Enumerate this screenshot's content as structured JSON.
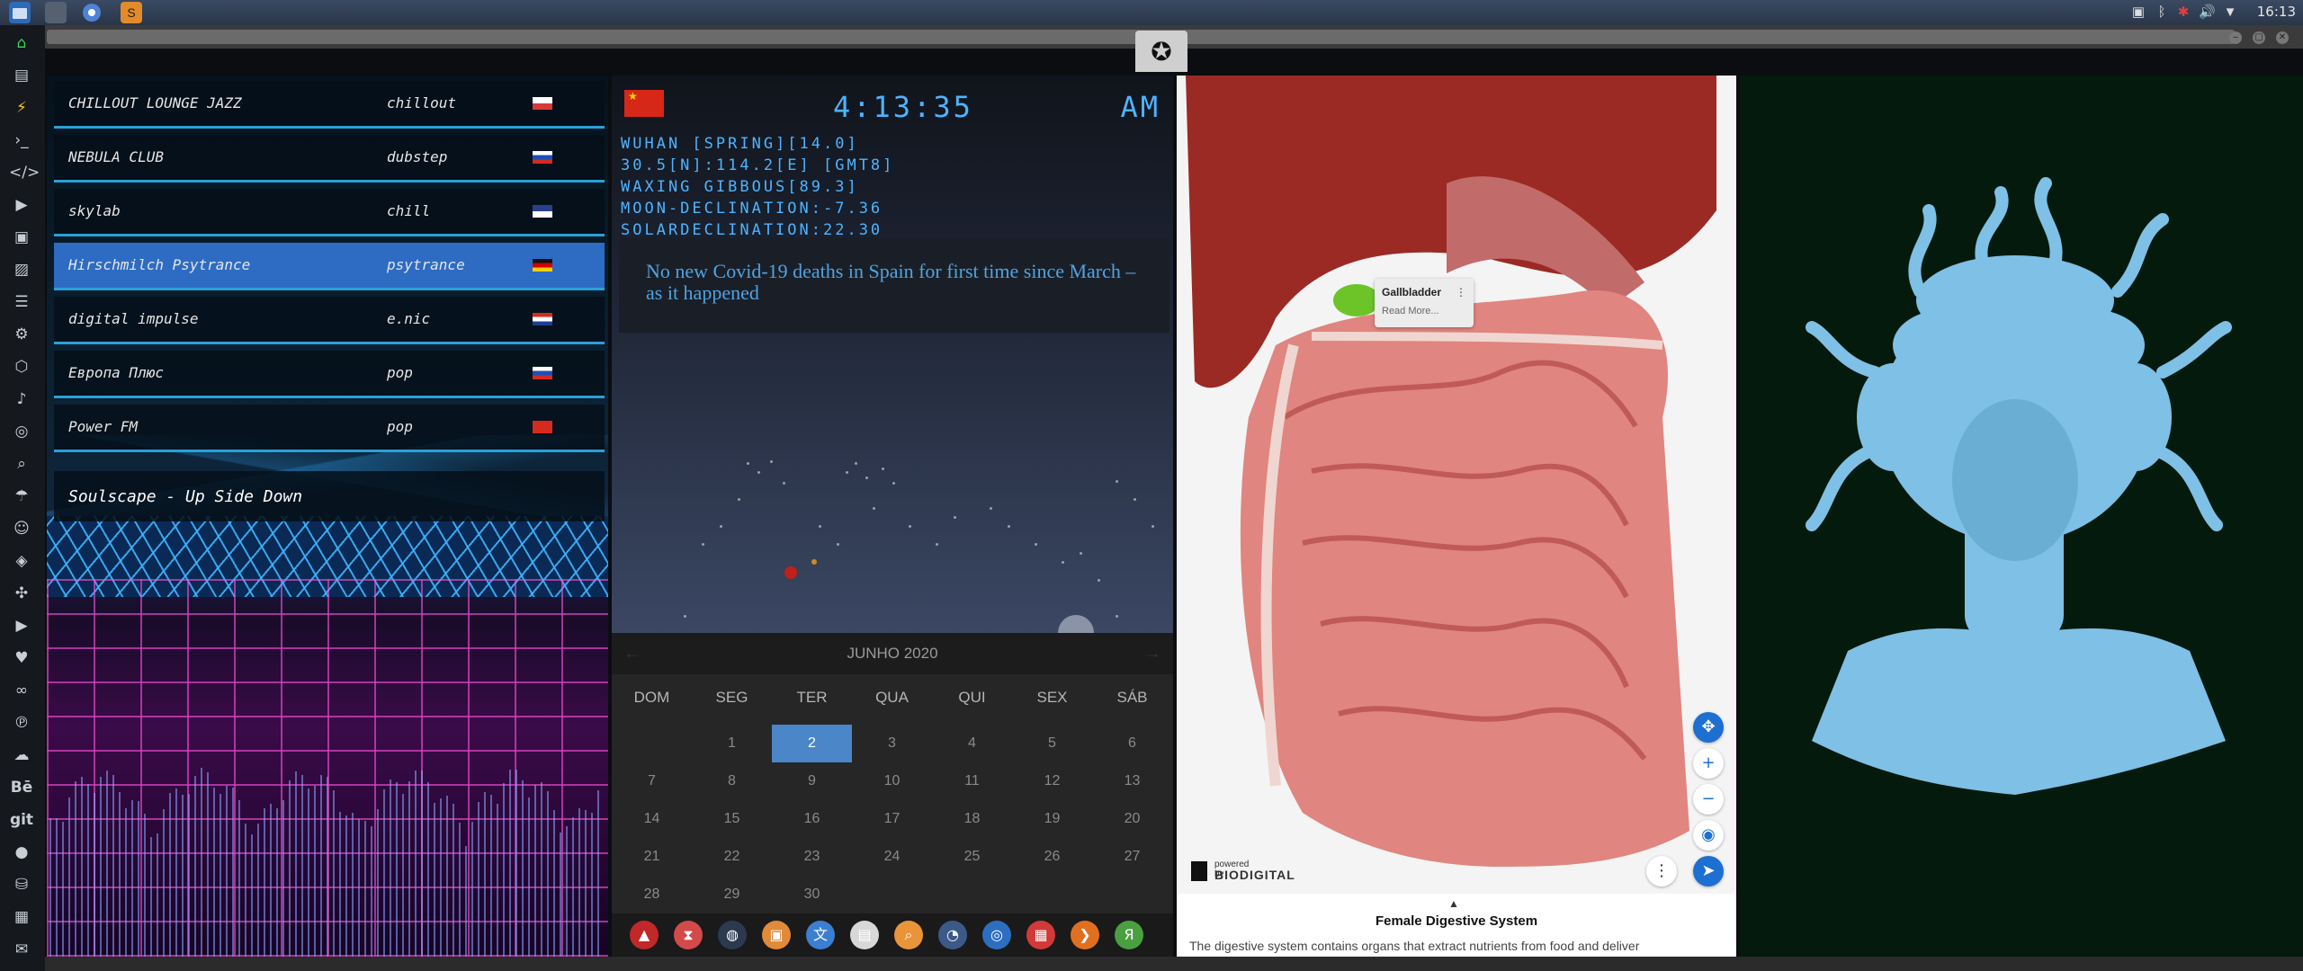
{
  "topbar": {
    "clock": "16:13",
    "launchers": [
      "files-icon",
      "app-icon",
      "chrome-icon",
      "sublime-icon"
    ],
    "tray": [
      "screenshot-icon",
      "bluetooth-icon",
      "alert-icon",
      "volume-icon",
      "wifi-icon"
    ]
  },
  "radio": {
    "stations": [
      {
        "name": "CHILLOUT LOUNGE JAZZ",
        "genre": "chillout",
        "flag": "flag-generic"
      },
      {
        "name": "NEBULA CLUB",
        "genre": "dubstep",
        "flag": "flag-russia"
      },
      {
        "name": "skylab",
        "genre": "chill",
        "flag": "flag-uk"
      },
      {
        "name": "Hirschmilch Psytrance",
        "genre": "psytrance",
        "flag": "flag-germany"
      },
      {
        "name": "digital impulse",
        "genre": "e.nic",
        "flag": "flag-croatia"
      },
      {
        "name": "Европа Плюс",
        "genre": "pop",
        "flag": "flag-russia"
      },
      {
        "name": "Power FM",
        "genre": "pop",
        "flag": "flag-turkey"
      }
    ],
    "active_index": 3,
    "now_playing": "Soulscape - Up Side Down"
  },
  "astro": {
    "time": "4:13:35",
    "ampm": "AM",
    "location": "WUHAN [SPRING][14.0]",
    "coords": "30.5[N]:114.2[E] [GMT8]",
    "moon_phase": "WAXING GIBBOUS[89.3]",
    "moon_declination": "MOON-DECLINATION:-7.36",
    "solar_declination": "SOLARDECLINATION:22.30",
    "news": "No new Covid-19 deaths in Spain for first time since March – as it happened"
  },
  "calendar": {
    "month": "JUNHO 2020",
    "weekdays": [
      "DOM",
      "SEG",
      "TER",
      "QUA",
      "QUI",
      "SEX",
      "SÁB"
    ],
    "weeks": [
      [
        "",
        "1",
        "2",
        "3",
        "4",
        "5",
        "6"
      ],
      [
        "7",
        "8",
        "9",
        "10",
        "11",
        "12",
        "13"
      ],
      [
        "14",
        "15",
        "16",
        "17",
        "18",
        "19",
        "20"
      ],
      [
        "21",
        "22",
        "23",
        "24",
        "25",
        "26",
        "27"
      ],
      [
        "28",
        "29",
        "30",
        "",
        "",
        "",
        ""
      ]
    ],
    "selected": "2"
  },
  "dock": {
    "apps": [
      "angular-icon",
      "hourglass-icon",
      "globe-dark-icon",
      "image-viewer-icon",
      "translate-icon",
      "news-icon",
      "search-app-icon",
      "clock-app-icon",
      "web-icon",
      "calendar-app-icon",
      "arrow-app-icon",
      "yandex-icon"
    ]
  },
  "anatomy": {
    "tooltip_title": "Gallbladder",
    "tooltip_link": "Read More...",
    "powered_by": "powered by",
    "brand": "BIODIGITAL",
    "title": "Female Digestive System",
    "description": "The digestive system contains organs that extract nutrients from food and deliver"
  },
  "colors": {
    "clock_blue": "#4fb3ff",
    "active_station": "#2d6cc2",
    "calendar_selected": "#4a86c8",
    "medusa": "#7ec0e6"
  }
}
